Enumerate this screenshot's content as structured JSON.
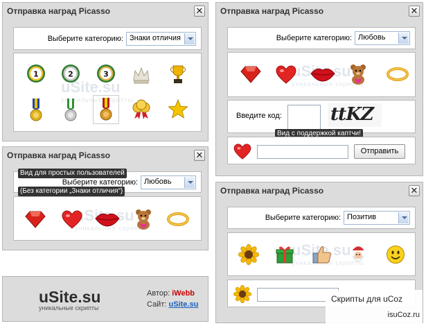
{
  "windows": {
    "w1": {
      "title": "Отправка наград Picasso",
      "category_label": "Выберите категорию:",
      "category_value": "Знаки отличия"
    },
    "w2": {
      "title": "Отправка наград Picasso",
      "category_label": "Выберите категорию:",
      "category_value": "Любовь",
      "captcha_label": "Введите код:",
      "captcha_text": "ttKZ",
      "captcha_tip": "Вид с поддержкой каптчи!",
      "send_button": "Отправить"
    },
    "w3": {
      "title": "Отправка наград Picasso",
      "category_label": "Выберите категорию:",
      "category_value": "Любовь",
      "tip_line1": "Вид для простых пользователей",
      "tip_line2": "(Без категории „Знаки отличия“)"
    },
    "w4": {
      "title": "Отправка наград Picasso",
      "category_label": "Выберите категорию:",
      "category_value": "Позитив"
    }
  },
  "close_symbol": "✕",
  "watermark": {
    "brand": "uSite.su",
    "tagline": "уникальные скрипты"
  },
  "credit": {
    "logo_brand": "uSite.su",
    "logo_tagline": "уникальные скрипты",
    "author_label": "Автор:",
    "author_name": "iWebb",
    "site_label": "Сайт:",
    "site_name": "uSite.su"
  },
  "ucoz": {
    "scripts_label": "Скрипты для uCoz",
    "domain": "isuCoz.ru"
  },
  "medal_numbers": [
    "1",
    "2",
    "3"
  ],
  "colors": {
    "window_bg": "#dcdcdc",
    "accent_red": "#cc0000",
    "link_blue": "#1560bd"
  }
}
